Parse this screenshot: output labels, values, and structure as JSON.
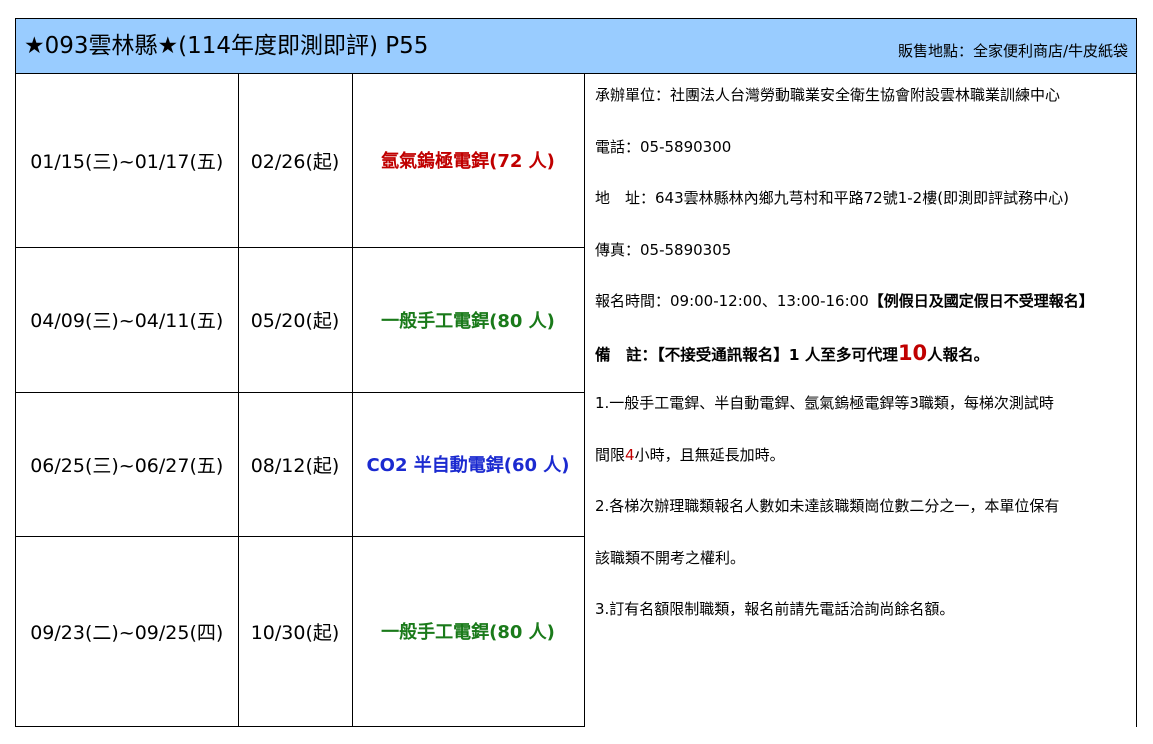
{
  "header": {
    "title": "★093雲林縣★(114年度即測即評) P55",
    "sales_location": "販售地點：全家便利商店/牛皮紙袋"
  },
  "schedule": [
    {
      "dates": "01/15(三)~01/17(五)",
      "start": "02/26(起)",
      "type": "氬氣鎢極電銲(72 人)",
      "type_color": "#c00000"
    },
    {
      "dates": "04/09(三)~04/11(五)",
      "start": "05/20(起)",
      "type": "一般手工電銲(80 人)",
      "type_color": "#1a7a1a"
    },
    {
      "dates": "06/25(三)~06/27(五)",
      "start": "08/12(起)",
      "type": "CO2 半自動電銲(60 人)",
      "type_color": "#1b2ad0"
    },
    {
      "dates": "09/23(二)~09/25(四)",
      "start": "10/30(起)",
      "type": "一般手工電銲(80 人)",
      "type_color": "#1a7a1a"
    }
  ],
  "info": {
    "organizer": "承辦單位：社團法人台灣勞動職業安全衛生協會附設雲林職業訓練中心",
    "phone": "電話：05-5890300",
    "address": "地　址：643雲林縣林內鄉九芎村和平路72號1-2樓(即測即評試務中心)",
    "fax": "傳真：05-5890305",
    "registration_time": "報名時間：09:00-12:00、13:00-16:00",
    "registration_note": "【例假日及國定假日不受理報名】",
    "remark_prefix": "備　註：【不接受通訊報名】1 人至多可代理",
    "remark_number": "10",
    "remark_suffix": "人報名。",
    "note1_a": "1.一般手工電銲、半自動電銲、氬氣鎢極電銲等3職類，每梯次測試時",
    "note1_b_prefix": "間限",
    "note1_b_hours": "4",
    "note1_b_suffix": "小時，且無延長加時。",
    "note2_a": "2.各梯次辦理職類報名人數如未達該職類崗位數二分之一，本單位保有",
    "note2_b": "該職類不開考之權利。",
    "note3": "3.訂有名額限制職類，報名前請先電話洽詢尚餘名額。"
  },
  "colors": {
    "header_bg": "#99ccff",
    "red": "#c00000",
    "green": "#1a7a1a",
    "blue": "#1b2ad0"
  }
}
